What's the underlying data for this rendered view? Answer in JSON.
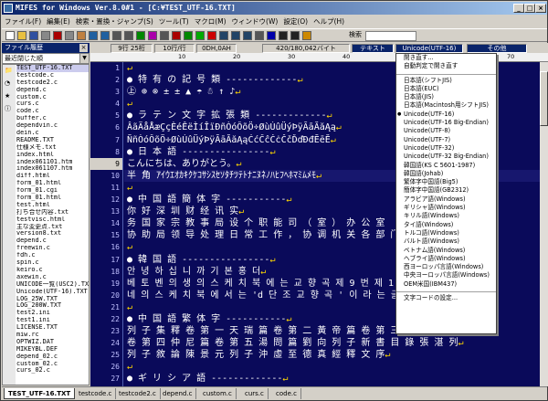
{
  "window": {
    "title": "MIFES for Windows Ver.8.0#1 - [C:¥TEST_UTF-16.TXT]"
  },
  "menu": [
    "ファイル(F)",
    "編集(E)",
    "検索・置換・ジャンプ(S)",
    "ツール(T)",
    "マクロ(M)",
    "ウィンドウ(W)",
    "設定(O)",
    "ヘルプ(H)"
  ],
  "toolbar": {
    "search_label": "検索"
  },
  "left_panel": {
    "header": "ファイル履歴",
    "sort_select": "最近閉じた順",
    "files": [
      "TEST_UTF-16.TXT",
      "testcode.c",
      "testcode2.c",
      "depend.c",
      "custom.c",
      "curs.c",
      "code.c",
      "buffer.c",
      "dependvin.c",
      "dein.c",
      "README.TXT",
      "仕様メモ.txt",
      "index.html",
      "index061101.htm",
      "index061107.htm",
      "diff.html",
      "form_01.html",
      "form_01.cgi",
      "form_01.html",
      "test.html",
      "打ち合せ内容.txt",
      "testvisc.html",
      "主な変更点.txt",
      "version8.txt",
      "depend.c",
      "freewin.c",
      "fdh.c",
      "spin.c",
      "keiro.c",
      "axewin.c",
      "UNICODE一覧(USC2).TXT",
      "Unicode(UTF-16).TXT",
      "LOG_25W.TXT",
      "LOG_200W.TXT",
      "test2.ini",
      "test1.ini",
      "LICENSE.TXT",
      "miw.rc",
      "OPTWIZ.DAT",
      "MIKEYBL.DEF",
      "depend_02.c",
      "custom_02.c",
      "curs_02.c"
    ]
  },
  "status": {
    "pos": "9行 25桁",
    "lines": "10行/行",
    "code": "0DH,0AH",
    "bytes": "420/180,042バイト",
    "mode": "テキスト",
    "encoding": "Unicode(UTF-16)",
    "other": "その他"
  },
  "ruler": [
    "10",
    "20",
    "30",
    "40",
    "50",
    "60",
    "70"
  ],
  "editor": {
    "current_line": 9,
    "lines": [
      "",
      "● 特 有 の 記 号 類 -------------",
      "  ㊤ ⊕ ⊗ ± ± ▲ ☂ ☃ ↑ ♪",
      "",
      "● ラ テ ン 文 字 拡 張 類 -------------",
      "  ÂãÄåÅæÇçÈéÊëÌíÎïÐñÒóÔõÖ÷ØùÚûÜýÞÿĀāĂăĄą",
      "  ÑñÒóÔõÖ÷ØùÚûÜýÞÿĀāĂăĄąĆćĈĉĊċČčĎďĐđĒēĔ",
      "● 日 本 語 ----------------",
      "  こんにちは、ありがとう。",
      "  半 角   ｱｲｳｴｵｶｷｸｹｺｻｼｽｾｿﾀﾁﾂﾃﾄﾅﾆﾇﾈﾉﾊﾋﾌﾍﾎﾏﾐﾑﾒﾓ",
      "",
      "● 中 国 語    簡 体 字 -----------",
      "  你 好  深 圳  财 经 讯 实",
      "  务 国 家 宗 教 事 局 设 个 职 能 司 （ 室 ） 办 公 室 （ 人 事 司",
      "  协 助 局 领 导 处 理 日 常 工 作 ， 协 调 机 关 各 部 门 的 工 作",
      "",
      "● 韓 国 語 ----------------",
      "  안 녕 하 십 니 까    기 본 홍 더",
      "  베 토 벤 의 생 의 스 케 치 북 에 는 교 향 곡 제 9 번 제 1 악 장",
      "  네 의 스 케 치 북 에 서 는 'd 단 조 교 향 곡 ' 이 라 는 글 을",
      "",
      "● 中 国 語    繁 体 字 -----------",
      "  列 子 集 釋 卷 第 一 天 瑞 篇 卷 第 二 黃 帝 篇 卷 第 三 周 穆 王 篇",
      "  卷 第 四 仲 尼 篇 卷 第 五 湯 問 篇 劉 向 列 子 新 書 目 錄 張 湛 列",
      "  列 子 敘 論 陳 景 元 列 子 沖 虛 至 德 真 經 釋 文 序",
      "",
      "● ギ リ シ ア 語 -------------",
      "  ΑαΒβΓγΔδΕεΖζΗηΘθΙιΚκΛλΜμΝνΞξΟο"
    ]
  },
  "encoding_menu": {
    "items": [
      "開き直す...",
      "自動判定で開き直す",
      "SEP",
      "日本語(シフトJIS)",
      "日本語(EUC)",
      "日本語(JIS)",
      "日本語(Macintosh用シフトJIS)",
      "Unicode(UTF-16)",
      "Unicode(UTF-16 Big-Endian)",
      "Unicode(UTF-8)",
      "Unicode(UTF-7)",
      "Unicode(UTF-32)",
      "Unicode(UTF-32 Big-Endian)",
      "韓国語(KS C 5601-1987)",
      "韓国語(Johab)",
      "繁体字中国語(Big5)",
      "簡体字中国語(GB2312)",
      "アラビア語(Windows)",
      "ギリシャ語(Windows)",
      "キリル語(Windows)",
      "タイ語(Windows)",
      "トルコ語(Windows)",
      "バルト語(Windows)",
      "ベトナム語(Windows)",
      "ヘブライ語(Windows)",
      "西ヨーロッパ言語(Windows)",
      "中央ヨーロッパ言語(Windows)",
      "OEM米国(IBM437)",
      "SEP",
      "文字コードの設定..."
    ],
    "checked": "Unicode(UTF-16)"
  },
  "tabs": [
    "TEST_UTF-16.TXT",
    "testcode.c",
    "testcode2.c",
    "depend.c",
    "custom.c",
    "curs.c",
    "code.c"
  ],
  "colors": {
    "editor_bg": "#0a0a5a",
    "title_bg": "#0a246a",
    "eol_mark": "#ffd700"
  }
}
